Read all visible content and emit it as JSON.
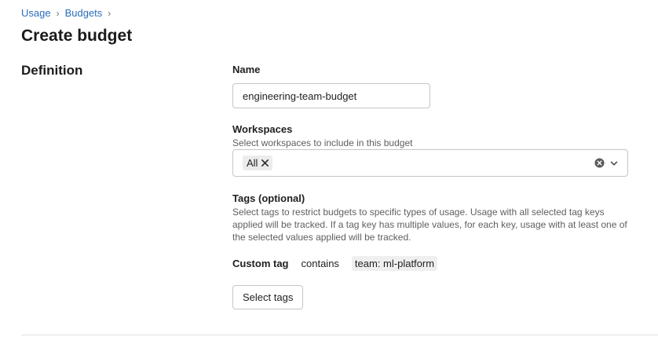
{
  "breadcrumb": {
    "items": [
      "Usage",
      "Budgets"
    ],
    "separator": "›"
  },
  "page": {
    "title": "Create budget"
  },
  "definition": {
    "section_title": "Definition",
    "name": {
      "label": "Name",
      "value": "engineering-team-budget"
    },
    "workspaces": {
      "label": "Workspaces",
      "help": "Select workspaces to include in this budget",
      "selected_chip": "All",
      "icons": [
        "close-icon",
        "clear-circle-icon",
        "chevron-down-icon"
      ]
    },
    "tags": {
      "label": "Tags (optional)",
      "help": "Select tags to restrict budgets to specific types of usage. Usage with all selected tag keys applied will be tracked. If a tag key has multiple values, for each key, usage with at least one of the selected values applied will be tracked.",
      "condition": {
        "key": "Custom tag",
        "operator": "contains",
        "value": "team: ml-platform"
      },
      "select_button": "Select tags"
    }
  },
  "colors": {
    "link": "#2a6ebb",
    "border": "#c6c6c6",
    "chip_bg": "#ececec"
  }
}
